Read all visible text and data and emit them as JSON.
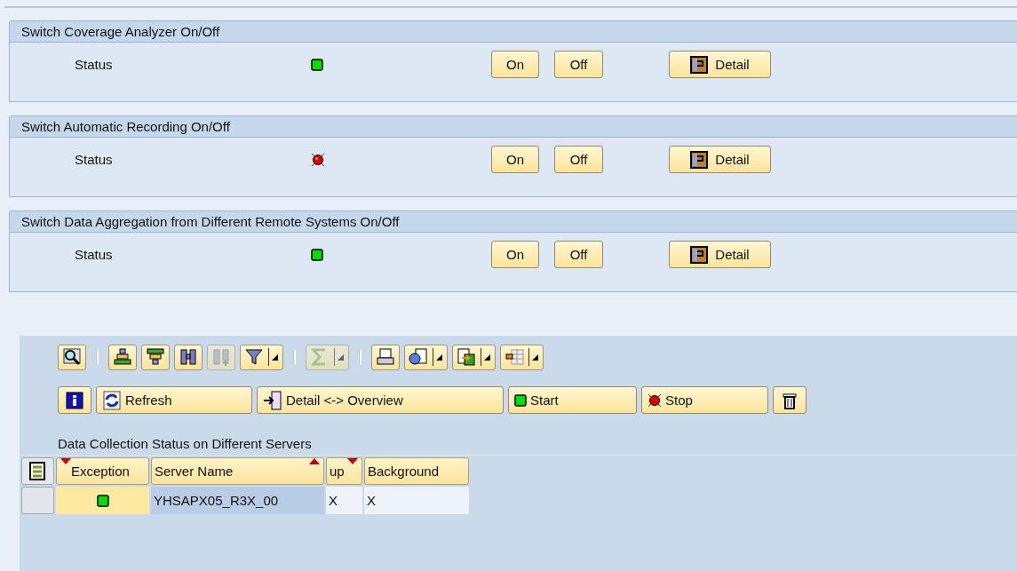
{
  "panels": [
    {
      "title": "Switch Coverage Analyzer On/Off",
      "label": "Status",
      "on": true,
      "buttons": [
        "On",
        "Off",
        "Detail"
      ]
    },
    {
      "title": "Switch Automatic Recording On/Off",
      "label": "Status",
      "on": false,
      "buttons": [
        "On",
        "Off",
        "Detail"
      ]
    },
    {
      "title": "Switch Data Aggregation from Different Remote Systems On/Off",
      "label": "Status",
      "on": true,
      "buttons": [
        "On",
        "Off",
        "Detail"
      ]
    }
  ],
  "toolbar": [
    {
      "kind": "button",
      "disabled": false,
      "menu": false
    },
    {
      "kind": "separator"
    },
    {
      "kind": "button",
      "disabled": false,
      "menu": false
    },
    {
      "kind": "button",
      "disabled": false,
      "menu": false
    },
    {
      "kind": "button",
      "disabled": false,
      "menu": false
    },
    {
      "kind": "button",
      "disabled": true,
      "menu": false
    },
    {
      "kind": "button",
      "disabled": false,
      "menu": true
    },
    {
      "kind": "separator"
    },
    {
      "kind": "button",
      "disabled": true,
      "menu": true
    },
    {
      "kind": "separator"
    },
    {
      "kind": "button",
      "disabled": false,
      "menu": false
    },
    {
      "kind": "button",
      "disabled": false,
      "menu": true
    },
    {
      "kind": "button",
      "disabled": false,
      "menu": true
    },
    {
      "kind": "button",
      "disabled": false,
      "menu": true
    }
  ],
  "actions": [
    {
      "kind": "icon"
    },
    {
      "kind": "text",
      "label": "Refresh"
    },
    {
      "kind": "text",
      "label": "Detail <-> Overview"
    },
    {
      "kind": "text",
      "label": "Start"
    },
    {
      "kind": "text",
      "label": "Stop"
    },
    {
      "kind": "icon"
    }
  ],
  "grid": {
    "title": "Data Collection Status on Different Servers",
    "columns": [
      {
        "label": "Exception",
        "filtered": true,
        "sort_asc": false,
        "sort_desc": false
      },
      {
        "label": "Server Name",
        "filtered": false,
        "sort_asc": true,
        "sort_desc": false
      },
      {
        "label": "up",
        "filtered": false,
        "sort_asc": false,
        "sort_desc": true
      },
      {
        "label": "Background",
        "filtered": false,
        "sort_asc": false,
        "sort_desc": false
      }
    ],
    "rows": [
      {
        "exception_on": true,
        "server_name": "YHSAPX05_R3X_00",
        "up": "X",
        "background": "X"
      }
    ]
  }
}
